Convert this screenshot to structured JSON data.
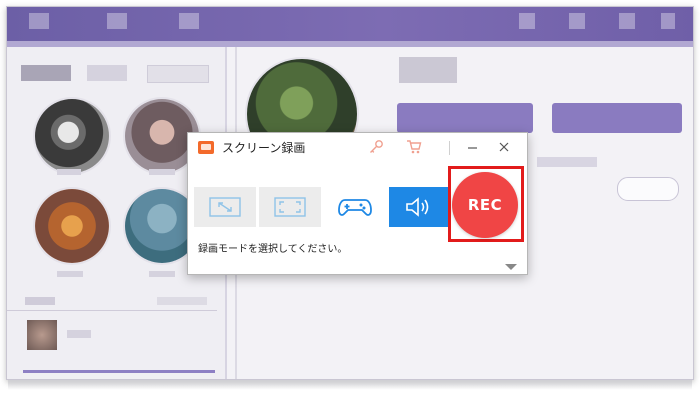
{
  "dialog": {
    "title": "スクリーン録画",
    "logo_icon": "screen-recorder-logo-icon",
    "toolbar_icons": [
      "key-icon",
      "cart-icon",
      "minimize-icon",
      "close-icon"
    ],
    "modes": [
      {
        "name": "region",
        "icon": "region-select-icon"
      },
      {
        "name": "fullscreen",
        "icon": "fullscreen-icon"
      },
      {
        "name": "game",
        "icon": "gamepad-icon"
      },
      {
        "name": "audio",
        "icon": "speaker-icon"
      }
    ],
    "rec_label": "REC",
    "status_text": "録画モードを選択してください。",
    "expand_icon": "chevron-down-icon"
  },
  "colors": {
    "accent_blue": "#1e88e5",
    "rec_red": "#f04545",
    "highlight_outline": "#e21b1b",
    "logo_orange": "#f36a2b",
    "background_purple": "#7566b0"
  }
}
